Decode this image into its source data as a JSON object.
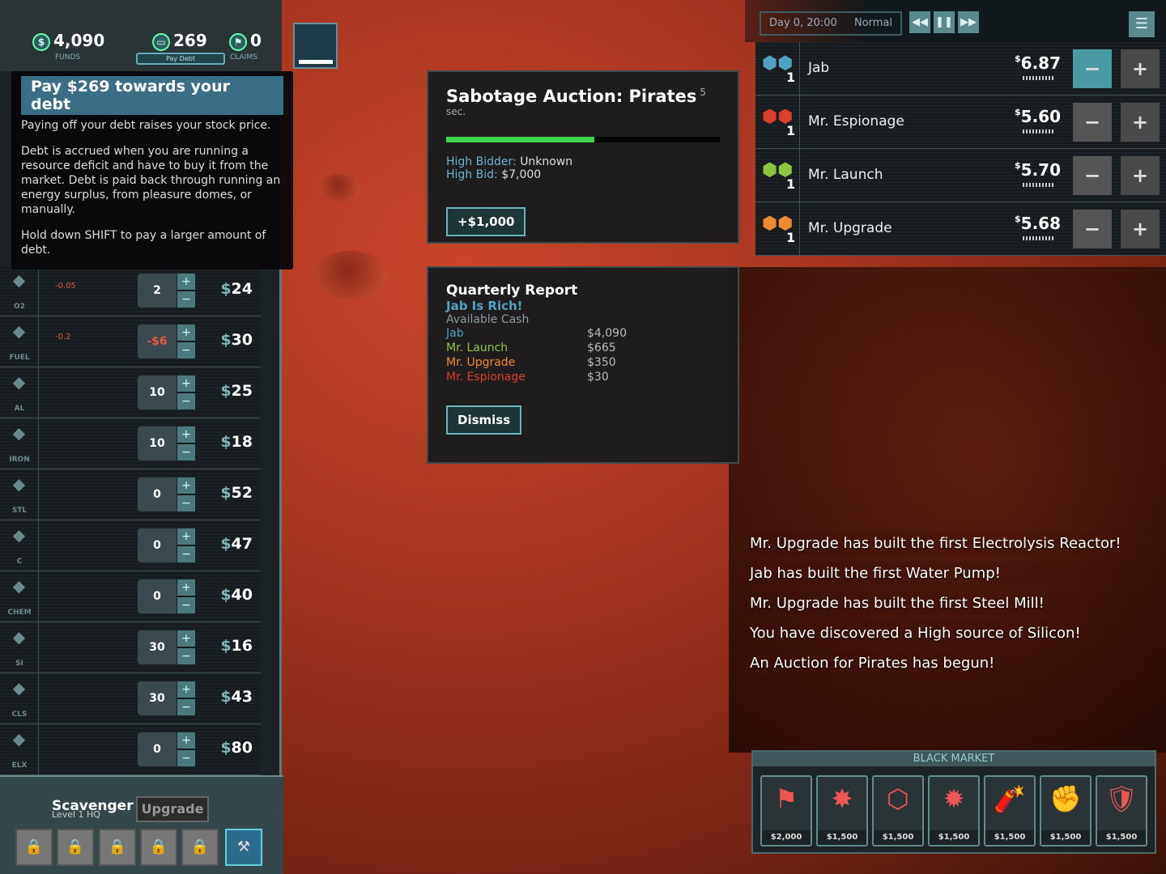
{
  "header": {
    "funds": "4,090",
    "funds_label": "FUNDS",
    "debt": "269",
    "pay_debt_label": "Pay Debt",
    "claims": "0",
    "claims_label": "CLAIMS"
  },
  "tooltip": {
    "title": "Pay $269 towards your debt",
    "p1": "Paying off your debt raises your stock price.",
    "p2": "Debt is accrued when you are running a resource deficit and have to buy it from the market. Debt is paid back through running an energy surplus, from pleasure domes, or manually.",
    "p3": "Hold down SHIFT to pay a larger amount of debt."
  },
  "resources": [
    {
      "name": "O2",
      "rate": "-0.05",
      "qty": "2",
      "price": "24",
      "icon": "gauge-icon"
    },
    {
      "name": "FUEL",
      "rate": "-0.2",
      "qty": "-$6",
      "price": "30",
      "icon": "flame-icon"
    },
    {
      "name": "AL",
      "rate": "",
      "qty": "10",
      "price": "25",
      "icon": "aluminum-icon"
    },
    {
      "name": "IRON",
      "rate": "",
      "qty": "10",
      "price": "18",
      "icon": "iron-bar-icon"
    },
    {
      "name": "STL",
      "rate": "",
      "qty": "0",
      "price": "52",
      "icon": "steel-icon"
    },
    {
      "name": "C",
      "rate": "",
      "qty": "0",
      "price": "47",
      "icon": "carbon-icon"
    },
    {
      "name": "CHEM",
      "rate": "",
      "qty": "0",
      "price": "40",
      "icon": "flask-icon"
    },
    {
      "name": "SI",
      "rate": "",
      "qty": "30",
      "price": "16",
      "icon": "silicon-icon"
    },
    {
      "name": "CLS",
      "rate": "",
      "qty": "30",
      "price": "43",
      "icon": "glass-icon"
    },
    {
      "name": "ELX",
      "rate": "",
      "qty": "0",
      "price": "80",
      "icon": "chip-icon"
    }
  ],
  "auction": {
    "title": "Sabotage Auction: Pirates",
    "timer": "5 sec.",
    "progress": 0.54,
    "bidder_label": "High Bidder:",
    "bidder": "Unknown",
    "bid_label": "High Bid:",
    "bid": "$7,000",
    "button": "+$1,000"
  },
  "report": {
    "title": "Quarterly Report",
    "headline": "Jab Is Rich!",
    "sub": "Available Cash",
    "rows": [
      {
        "name": "Jab",
        "cash": "$4,090",
        "color": "#4fa3c0"
      },
      {
        "name": "Mr. Launch",
        "cash": "$665",
        "color": "#8cc63f"
      },
      {
        "name": "Mr. Upgrade",
        "cash": "$350",
        "color": "#f08a30"
      },
      {
        "name": "Mr. Espionage",
        "cash": "$30",
        "color": "#d8402c"
      }
    ],
    "button": "Dismiss"
  },
  "time": {
    "day": "Day 0, 20:00",
    "speed": "Normal"
  },
  "players": [
    {
      "name": "Jab",
      "price": "6.87",
      "shares": "1",
      "color": "#4fa3c0"
    },
    {
      "name": "Mr. Espionage",
      "price": "5.60",
      "shares": "1",
      "color": "#d8402c"
    },
    {
      "name": "Mr. Launch",
      "price": "5.70",
      "shares": "1",
      "color": "#8cc63f"
    },
    {
      "name": "Mr. Upgrade",
      "price": "5.68",
      "shares": "1",
      "color": "#f08a30"
    }
  ],
  "messages": [
    "Mr. Upgrade has built the first Electrolysis Reactor!",
    "Jab has built the first Water Pump!",
    "Mr. Upgrade has built the first Steel Mill!",
    "You have discovered a High source of Silicon!",
    "An Auction for Pirates has begun!"
  ],
  "black_market": {
    "title": "BLACK MARKET",
    "items": [
      {
        "icon": "flag-icon",
        "cost": "$2,000"
      },
      {
        "icon": "power-surge-icon",
        "cost": "$1,500"
      },
      {
        "icon": "hex-chain-icon",
        "cost": "$1,500"
      },
      {
        "icon": "explosion-icon",
        "cost": "$1,500"
      },
      {
        "icon": "dynamite-icon",
        "cost": "$1,500"
      },
      {
        "icon": "fist-icon",
        "cost": "$1,500"
      },
      {
        "icon": "shield-icon",
        "cost": "$1,500"
      }
    ]
  },
  "hq": {
    "name": "Scavenger",
    "level": "Level 1 HQ",
    "upgrade": "Upgrade"
  }
}
